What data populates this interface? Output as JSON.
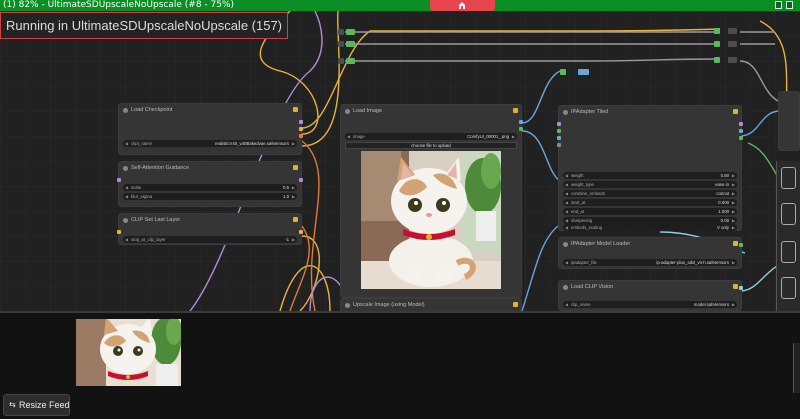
{
  "window": {
    "title": "(1) 82% - UltimateSDUpscaleNoUpscale (#8 - 75%)",
    "accent": "#0b8f24",
    "menu_color": "#e6454d"
  },
  "canvas": {
    "status_text": "Running in UltimateSDUpscaleNoUpscale (157)",
    "nodes": {
      "load_checkpoint": {
        "title": "Load Checkpoint",
        "ckpt_label": "ckpt_name",
        "ckpt_value": "realisticV40_v40Bakedvae.safetensors"
      },
      "self_attention": {
        "title": "Self-Attention Guidance",
        "scale_label": "scale",
        "scale_value": "0.5",
        "blur_label": "blur_sigma",
        "blur_value": "1.0"
      },
      "clip_set_last_layer": {
        "title": "CLIP Set Last Layer",
        "stop_label": "stop_at_clip_layer",
        "stop_value": "-1"
      },
      "load_image": {
        "title": "Load Image",
        "image_label": "image",
        "image_value": "ComfyUI_00001_.png",
        "upload_label": "choose file to upload"
      },
      "upscale_image": {
        "title": "Upscale Image (using Model)"
      },
      "ipadapter_tiled": {
        "title": "IPAdapter Tiled",
        "rows": [
          {
            "label": "weight",
            "value": "0.80"
          },
          {
            "label": "weight_type",
            "value": "ease in"
          },
          {
            "label": "combine_embeds",
            "value": "concat"
          },
          {
            "label": "start_at",
            "value": "0.000"
          },
          {
            "label": "end_at",
            "value": "1.000"
          },
          {
            "label": "sharpening",
            "value": "0.00"
          },
          {
            "label": "embeds_scaling",
            "value": "V only"
          }
        ]
      },
      "ipadapter_loader": {
        "title": "IPAdapter Model Loader",
        "file_label": "ipadapter_file",
        "file_value": "ip-adapter-plus_sdxl_vit-h.safetensors"
      },
      "load_clip_vision": {
        "title": "Load CLIP Vision",
        "clip_label": "clip_name",
        "clip_value": "model.safetensors"
      }
    }
  },
  "feed": {
    "resize_label": "Resize Feed",
    "resize_icon": "resize-icon"
  }
}
